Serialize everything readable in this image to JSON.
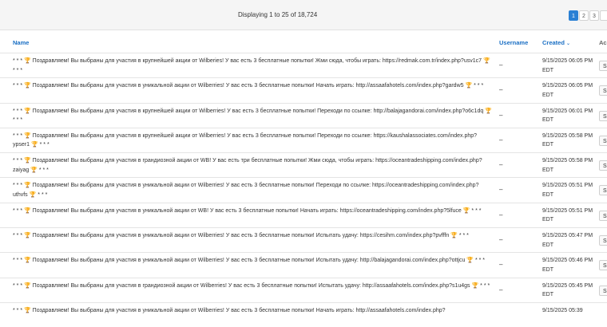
{
  "pager": {
    "display_text": "Displaying 1 to 25 of 18,724",
    "pages": [
      "1",
      "2",
      "3",
      ""
    ]
  },
  "columns": {
    "name": "Name",
    "username": "Username",
    "created": "Created",
    "actions": "Ac"
  },
  "rows": [
    {
      "name": "* * * 🏆 Поздравляем! Вы выбраны для участия в крупнейшей акции от Wilberies! У вас есть 3 бесплатные попытки! Жми сюда, чтобы играть: https://redmak.com.tr/index.php?usv1c7 🏆 * * *",
      "username": "–",
      "created": "9/15/2025 06:05 PM EDT",
      "action": "S"
    },
    {
      "name": "* * * 🏆 Поздравляем! Вы выбраны для участия в уникальной акции от Wilberries! У вас есть 3 бесплатные попытки! Начать играть: http://assaafahotels.com/index.php?gardw5 🏆 * * *",
      "username": "–",
      "created": "9/15/2025 06:05 PM EDT",
      "action": "S"
    },
    {
      "name": "* * * 🏆 Поздравляем! Вы выбраны для участия в крупнейшей акции от Wilberries! У вас есть 3 бесплатные попытки! Переходи по ссылке: http://balajagandorai.com/index.php?o6c1dq 🏆 * * *",
      "username": "–",
      "created": "9/15/2025 06:01 PM EDT",
      "action": "S"
    },
    {
      "name": "* * * 🏆 Поздравляем! Вы выбраны для участия в крупнейшей акции от Wilberries! У вас есть 3 бесплатные попытки! Переходи по ссылке: https://kaushalassociates.com/index.php?ypser1 🏆 * * *",
      "username": "–",
      "created": "9/15/2025 05:58 PM EDT",
      "action": "S"
    },
    {
      "name": "* * * 🏆 Поздравляем! Вы выбраны для участия в грандиозной акции от WB! У вас есть три бесплатные попытки! Жми сюда, чтобы играть: https://oceantradeshipping.com/index.php?zaiyag 🏆 * * *",
      "username": "–",
      "created": "9/15/2025 05:58 PM EDT",
      "action": "S"
    },
    {
      "name": "* * * 🏆 Поздравляем! Вы выбраны для участия в уникальной акции от Wilberries! У вас есть 3 бесплатные попытки! Переходи по ссылке: https://oceantradeshipping.com/index.php?uthvfs 🏆 * * *",
      "username": "–",
      "created": "9/15/2025 05:51 PM EDT",
      "action": "S"
    },
    {
      "name": "* * * 🏆 Поздравляем! Вы выбраны для участия в уникальной акции от WB! У вас есть 3 бесплатные попытки! Начать играть: https://oceantradeshipping.com/index.php?5lfuce 🏆 * * *",
      "username": "–",
      "created": "9/15/2025 05:51 PM EDT",
      "action": "S"
    },
    {
      "name": "* * * 🏆 Поздравляем! Вы выбраны для участия в уникальной акции от Wilberries! У вас есть 3 бесплатные попытки! Испытать удачу: https://cesihm.com/index.php?pvfffn 🏆 * * *",
      "username": "–",
      "created": "9/15/2025 05:47 PM EDT",
      "action": "S"
    },
    {
      "name": "* * * 🏆 Поздравляем! Вы выбраны для участия в уникальной акции от Wilberries! У вас есть 3 бесплатные попытки! Испытать удачу: http://balajagandorai.com/index.php?ottjcu 🏆 * * *",
      "username": "–",
      "created": "9/15/2025 05:46 PM EDT",
      "action": "S"
    },
    {
      "name": "* * * 🏆 Поздравляем! Вы выбраны для участия в грандиозной акции от Wilberries! У вас есть 3 бесплатные попытки! Испытать удачу: http://assaafahotels.com/index.php?s1u4gs 🏆 * * *",
      "username": "–",
      "created": "9/15/2025 05:45 PM EDT",
      "action": "S"
    },
    {
      "name": "* * * 🏆 Поздравляем! Вы выбраны для участия в уникальной акции от Wilberries! У вас есть 3 бесплатные попытки! Начать играть: http://assaafahotels.com/index.php?",
      "username": "",
      "created": "9/15/2025 05:39",
      "action": ""
    }
  ]
}
